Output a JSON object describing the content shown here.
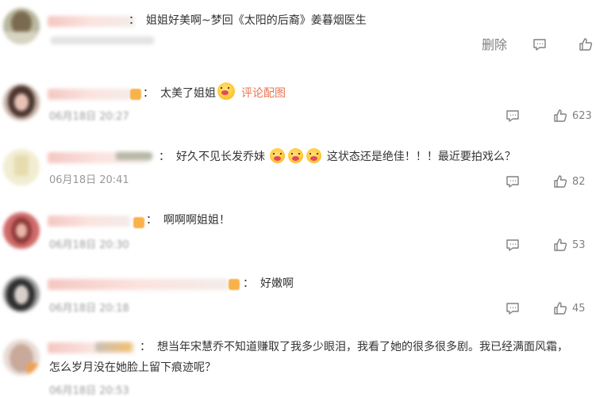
{
  "comments": [
    {
      "text": "姐姐好美啊~梦回《太阳的后裔》姜暮烟医生",
      "has_delete": true,
      "delete_label": "删除",
      "likes": ""
    },
    {
      "text": "太美了姐姐",
      "link": "评论配图",
      "time": "06月18日 20:27",
      "likes": "623"
    },
    {
      "text_pre": "好久不见长发乔妹",
      "text_post": "这状态还是绝佳！！！最近要拍戏么？",
      "time": "06月18日 20:41",
      "likes": "82"
    },
    {
      "text": "啊啊啊姐姐！",
      "time": "06月18日 20:30",
      "likes": "53"
    },
    {
      "text": "好嫩啊",
      "time": "06月18日 20:18",
      "likes": "45"
    },
    {
      "text_line1": "想当年宋慧乔不知道赚取了我多少眼泪，我看了她的很多很多剧。我已经满面风霜，",
      "text_line2": "怎么岁月没在她脸上留下痕迹呢？",
      "time": "06月18日 20:53"
    }
  ],
  "colon": "：",
  "icons": {
    "comment": "comment-icon",
    "like": "thumbs-up-icon"
  },
  "colors": {
    "link": "#eb7350",
    "meta": "#999999",
    "text": "#333333"
  }
}
